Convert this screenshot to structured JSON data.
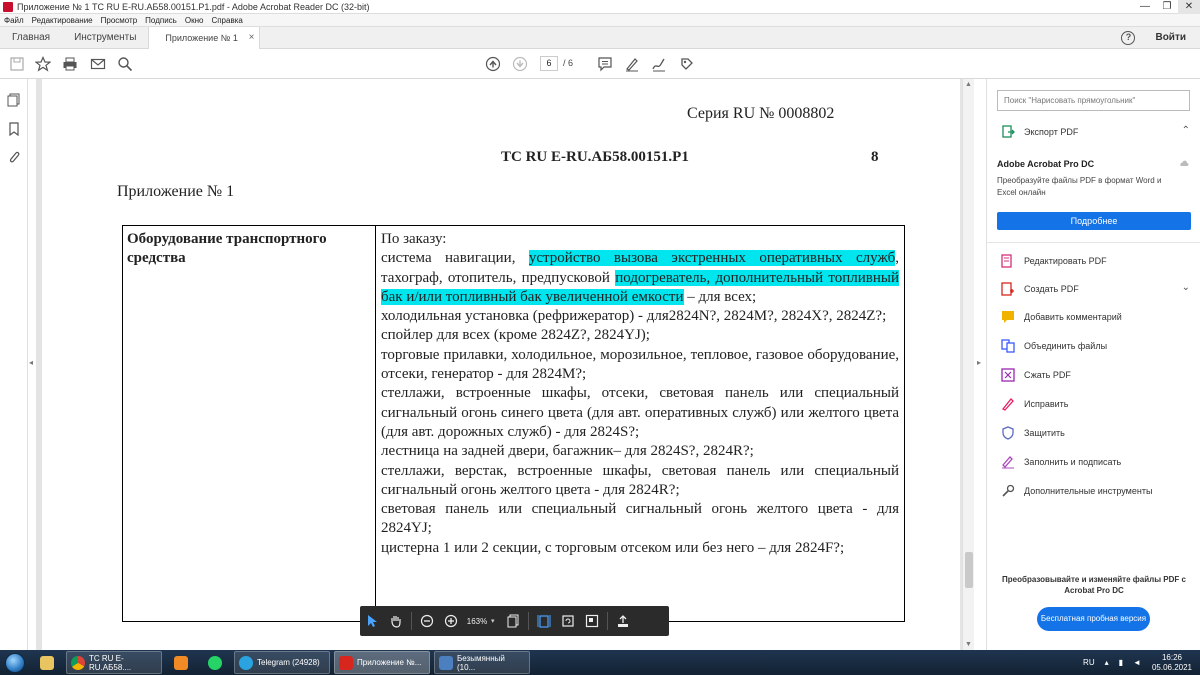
{
  "window": {
    "title": "Приложение № 1 ТС RU E-RU.АБ58.00151.P1.pdf - Adobe Acrobat Reader DC (32-bit)",
    "minimize": "—",
    "maximize": "❐",
    "close": "✕"
  },
  "menu": [
    "Файл",
    "Редактирование",
    "Просмотр",
    "Подпись",
    "Окно",
    "Справка"
  ],
  "tabs": {
    "home": "Главная",
    "tools": "Инструменты",
    "doc": "Приложение № 1 ...",
    "doc_close": "×",
    "help": "?",
    "signin": "Войти"
  },
  "toolbar": {
    "page_current": "6",
    "page_total": "/ 6"
  },
  "document": {
    "series": "Серия RU № 0008802",
    "tc_number": "ТС RU E-RU.АБ58.00151.P1",
    "page_number": "8",
    "appendix": "Приложение № 1",
    "left_cell": "Оборудование транспортного средства",
    "intro": "По заказу:",
    "p1_a": "система навигации, ",
    "p1_hl1": "устройство вызова экстренных оперативных служб",
    "p1_b": ", тахограф, отопитель, предпусковой ",
    "p1_hl2": "подогреватель, дополнительный топливный бак и/или топливный бак увеличенной емкости",
    "p1_c": " – для всех;",
    "p2": "холодильная установка (рефрижератор) - для2824N?, 2824M?, 2824X?, 2824Z?;",
    "p3": "спойлер для всех (кроме 2824Z?, 2824YJ);",
    "p4": "торговые прилавки, холодильное, морозильное, тепловое, газовое оборудование, отсеки, генератор - для 2824M?;",
    "p5": "стеллажи, встроенные шкафы, отсеки, световая панель или специальный сигнальный огонь синего цвета (для авт. оперативных служб) или желтого цвета (для авт. дорожных служб) - для 2824S?;",
    "p6": "лестница на задней двери, багажник– для 2824S?, 2824R?;",
    "p7": "стеллажи, верстак, встроенные шкафы, световая панель или специальный сигнальный огонь желтого цвета - для 2824R?;",
    "p8": "световая панель или специальный сигнальный огонь желтого цвета - для 2824YJ;",
    "p9": "цистерна 1 или 2 секции, с торговым отсеком или без него – для 2824F?;"
  },
  "right_panel": {
    "search_placeholder": "Поиск \"Нарисовать прямоугольник\"",
    "export_pdf": "Экспорт PDF",
    "promo_title": "Adobe Acrobat Pro DC",
    "promo_text": "Преобразуйте файлы PDF в формат Word и Excel онлайн",
    "more_button": "Подробнее",
    "tools": [
      "Редактировать PDF",
      "Создать PDF",
      "Добавить комментарий",
      "Объединить файлы",
      "Сжать PDF",
      "Исправить",
      "Защитить",
      "Заполнить и подписать",
      "Дополнительные инструменты"
    ],
    "trial_text": "Преобразовывайте и изменяйте файлы PDF с Acrobat Pro DC",
    "trial_button": "Бесплатная пробная версия"
  },
  "floatbar": {
    "zoom": "163%"
  },
  "taskbar": {
    "apps": [
      {
        "label": "TC RU E-RU.АБ58....",
        "color": "#e8e8e8"
      },
      {
        "label": "Telegram (24928)",
        "color": "#2aa3e0"
      },
      {
        "label": "Приложение №...",
        "color": "#d7261e"
      },
      {
        "label": "Безымянный (10...",
        "color": "#4c7fbf"
      }
    ],
    "lang": "RU",
    "time": "16:26",
    "date": "05.06.2021"
  },
  "colors": {
    "highlight": "#00e5ee",
    "accent_blue": "#1473e6",
    "taskbar": "#1f3550"
  }
}
